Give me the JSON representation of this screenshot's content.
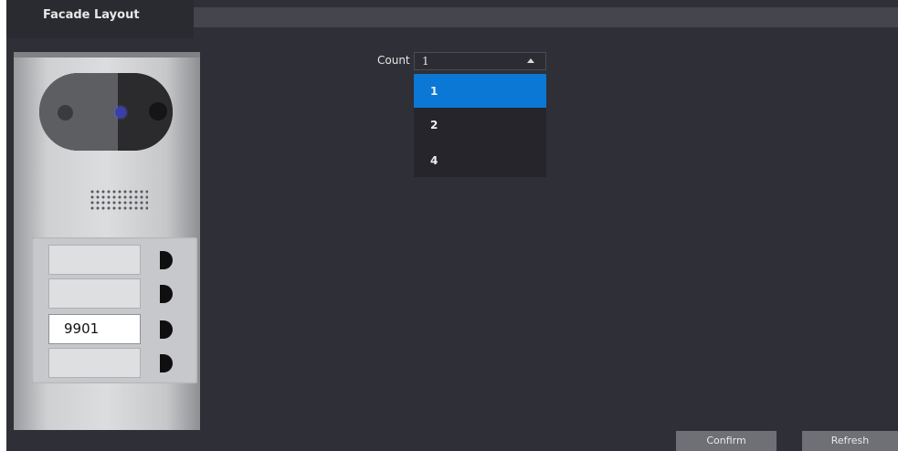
{
  "header": {
    "title": "Facade Layout"
  },
  "facade": {
    "name_slots": [
      "",
      "",
      "9901",
      ""
    ]
  },
  "count_selector": {
    "label": "Count",
    "selected_value": "1",
    "options": [
      "1",
      "2",
      "4"
    ]
  },
  "actions": {
    "confirm_label": "Confirm",
    "refresh_label": "Refresh"
  },
  "colors": {
    "background": "#2f2f37",
    "selected_option": "#0a78d4",
    "button": "#6f6f76"
  }
}
